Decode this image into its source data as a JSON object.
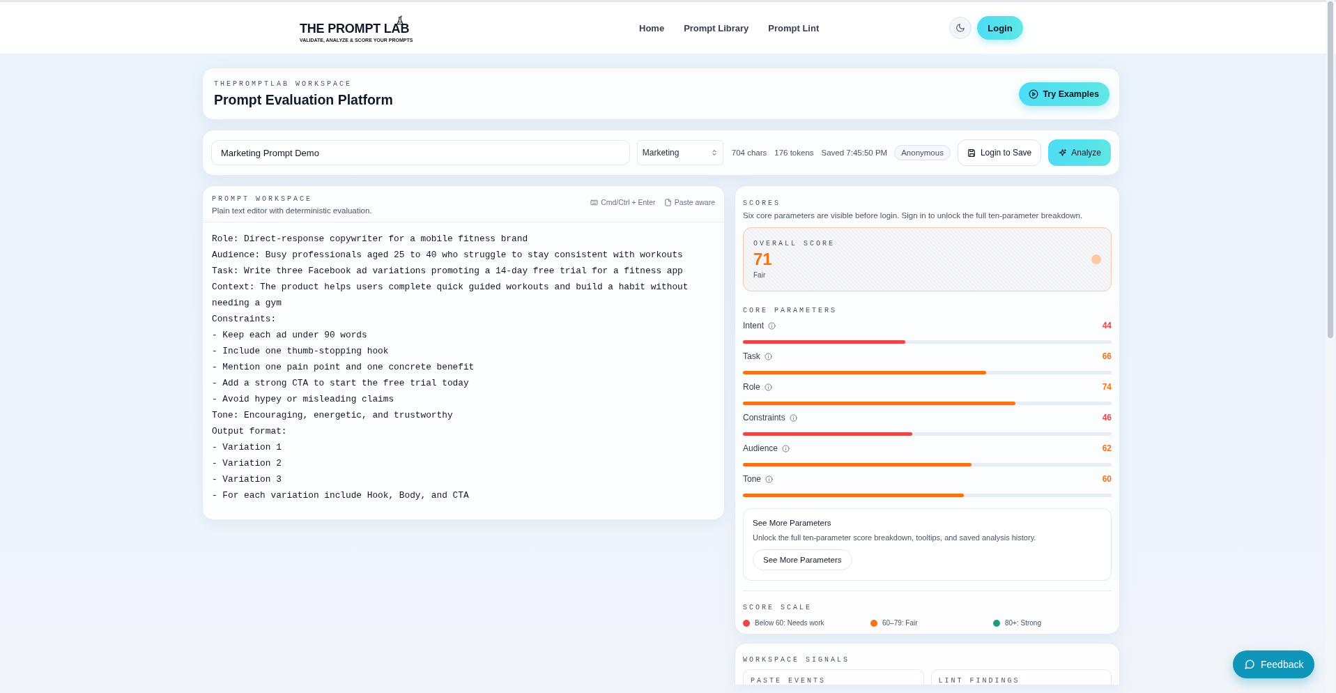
{
  "header": {
    "logo": {
      "title": "THE PROMPT LAB",
      "tagline": "VALIDATE, ANALYZE & SCORE YOUR PROMPTS"
    },
    "nav": [
      {
        "label": "Home"
      },
      {
        "label": "Prompt Library"
      },
      {
        "label": "Prompt Lint"
      }
    ],
    "login": "Login"
  },
  "title_card": {
    "eyebrow": "THEPROMPTLAB WORKSPACE",
    "title": "Prompt Evaluation Platform",
    "button": "Try Examples"
  },
  "toolbar": {
    "prompt_name": "Marketing Prompt Demo",
    "category": "Marketing",
    "chars": "704 chars",
    "tokens": "176 tokens",
    "saved": "Saved 7:45:50 PM",
    "user": "Anonymous",
    "save_button": "Login to Save",
    "analyze_button": "Analyze"
  },
  "editor": {
    "eyebrow": "PROMPT WORKSPACE",
    "subtitle": "Plain text editor with deterministic evaluation.",
    "hints": [
      {
        "kind": "keyboard",
        "label": "Cmd/Ctrl + Enter"
      },
      {
        "kind": "paste",
        "label": "Paste aware"
      }
    ],
    "lines": [
      "Role: Direct-response copywriter for a mobile fitness brand",
      "Audience: Busy professionals aged 25 to 40 who struggle to stay consistent with workouts",
      "Task: Write three Facebook ad variations promoting a 14-day free trial for a fitness app",
      "Context: The product helps users complete quick guided workouts and build a habit without needing a gym",
      "Constraints:",
      "- Keep each ad under 90 words",
      "- Include one thumb-stopping hook",
      "- Mention one pain point and one concrete benefit",
      "- Add a strong CTA to start the free trial today",
      "- Avoid hypey or misleading claims",
      "Tone: Encouraging, energetic, and trustworthy",
      "Output format:",
      "- Variation 1",
      "- Variation 2",
      "- Variation 3",
      "- For each variation include Hook, Body, and CTA"
    ]
  },
  "scores": {
    "eyebrow": "SCORES",
    "subtitle": "Six core parameters are visible before login. Sign in to unlock the full ten-parameter breakdown.",
    "overall": {
      "label": "OVERALL SCORE",
      "value": "71",
      "rating": "Fair"
    },
    "core_label": "CORE PARAMETERS",
    "parameters": [
      {
        "name": "Intent",
        "score": "44",
        "level": 0.44,
        "color": "#ef4444"
      },
      {
        "name": "Task",
        "score": "66",
        "level": 0.66,
        "color": "#f97316"
      },
      {
        "name": "Role",
        "score": "74",
        "level": 0.74,
        "color": "#f97316"
      },
      {
        "name": "Constraints",
        "score": "46",
        "level": 0.46,
        "color": "#ef4444"
      },
      {
        "name": "Audience",
        "score": "62",
        "level": 0.62,
        "color": "#f97316"
      },
      {
        "name": "Tone",
        "score": "60",
        "level": 0.6,
        "color": "#f97316"
      }
    ],
    "more": {
      "title": "See More Parameters",
      "text": "Unlock the full ten-parameter score breakdown, tooltips, and saved analysis history.",
      "button": "See More Parameters"
    },
    "scale_label": "SCORE SCALE",
    "scale": [
      {
        "label": "Below 60: Needs work",
        "color": "#ef4444"
      },
      {
        "label": "60–79: Fair",
        "color": "#f97316"
      },
      {
        "label": "80+: Strong",
        "color": "#1f9e7a"
      }
    ]
  },
  "signals": {
    "eyebrow": "WORKSPACE SIGNALS",
    "cards": [
      {
        "title": "PASTE EVENTS"
      },
      {
        "title": "LINT FINDINGS"
      }
    ]
  },
  "feedback": "Feedback"
}
